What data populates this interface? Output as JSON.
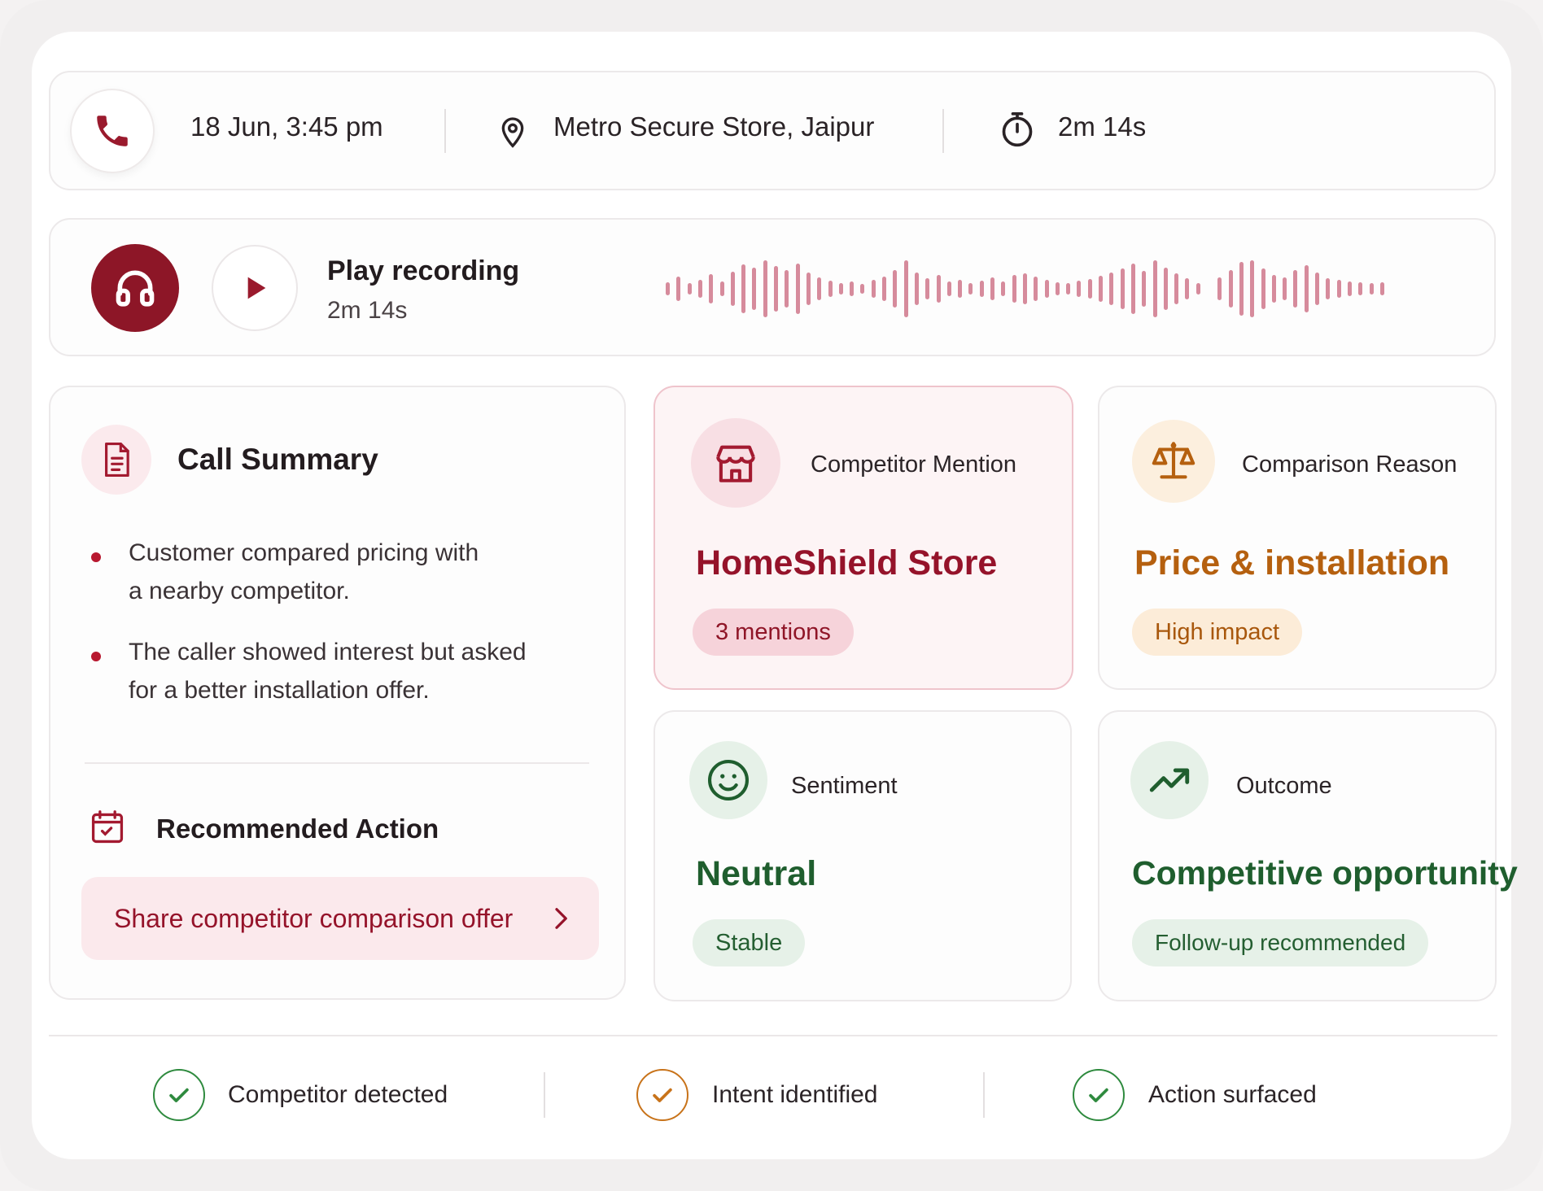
{
  "call": {
    "datetime": "18 Jun, 3:45 pm",
    "location": "Metro Secure Store, Jaipur",
    "duration": "2m 14s"
  },
  "player": {
    "title": "Play recording",
    "duration": "2m 14s"
  },
  "summary": {
    "title": "Call Summary",
    "bullets": [
      {
        "line1": "Customer compared pricing with",
        "line2": "a nearby competitor."
      },
      {
        "line1": "The caller showed interest but asked",
        "line2": "for a better installation offer."
      }
    ],
    "recommended_title": "Recommended Action",
    "recommended_action": "Share competitor comparison offer"
  },
  "metrics": {
    "competitor": {
      "label": "Competitor Mention",
      "value": "HomeShield Store",
      "badge": "3 mentions"
    },
    "reason": {
      "label": "Comparison Reason",
      "value": "Price & installation",
      "badge": "High impact"
    },
    "sentiment": {
      "label": "Sentiment",
      "value": "Neutral",
      "badge": "Stable"
    },
    "outcome": {
      "label": "Outcome",
      "value": "Competitive opportunity",
      "badge": "Follow-up recommended"
    }
  },
  "status": [
    {
      "label": "Competitor detected",
      "color": "#2e8a3e"
    },
    {
      "label": "Intent identified",
      "color": "#c8731a"
    },
    {
      "label": "Action surfaced",
      "color": "#2e8a3e"
    }
  ],
  "colors": {
    "brand": "#8d1627",
    "accent_red": "#95132a",
    "accent_orange": "#b5600f",
    "accent_green": "#1f5e2e"
  }
}
